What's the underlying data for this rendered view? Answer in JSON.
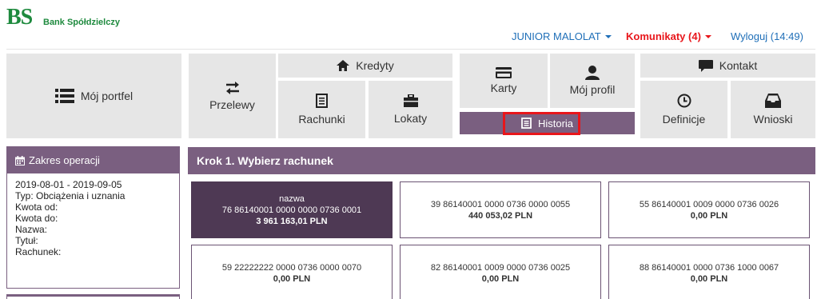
{
  "header": {
    "logo_main": "BS",
    "logo_sub": "Bank Spółdzielczy",
    "user": "JUNIOR MALOLAT",
    "komunikaty": "Komunikaty (4)",
    "wyloguj": "Wyloguj (14:49)"
  },
  "tiles": {
    "portfel": "Mój portfel",
    "przelewy": "Przelewy",
    "kredyty": "Kredyty",
    "rachunki": "Rachunki",
    "lokaty": "Lokaty",
    "karty": "Karty",
    "profil": "Mój profil",
    "historia": "Historia",
    "kontakt": "Kontakt",
    "definicje": "Definicje",
    "wnioski": "Wnioski"
  },
  "filters": {
    "title": "Zakres operacji",
    "lines": [
      "2019-08-01 - 2019-09-05",
      "Typ: Obciążenia i uznania",
      "Kwota od:",
      "Kwota do:",
      "Nazwa:",
      "Tytuł:",
      "Rachunek:"
    ]
  },
  "step": {
    "title": "Krok 1. Wybierz rachunek"
  },
  "accounts": [
    {
      "name": "nazwa",
      "number": "76 86140001 0000 0000 0736 0001",
      "amount": "3 961 163,01 PLN"
    },
    {
      "name": "",
      "number": "39 86140001 0000 0736 0000 0055",
      "amount": "440 053,02 PLN"
    },
    {
      "name": "",
      "number": "55 86140001 0009 0000 0736 0026",
      "amount": "0,00 PLN"
    },
    {
      "name": "",
      "number": "59 22222222 0000 0736 0000 0070",
      "amount": "0,00 PLN"
    },
    {
      "name": "",
      "number": "82 86140001 0009 0000 0736 0025",
      "amount": "0,00 PLN"
    },
    {
      "name": "",
      "number": "88 86140001 0000 0736 1000 0067",
      "amount": "0,00 PLN"
    }
  ],
  "icons": {
    "list": "list-icon",
    "transfer": "transfer-arrows-icon",
    "home": "home-icon",
    "document": "document-icon",
    "briefcase": "briefcase-icon",
    "card": "credit-card-icon",
    "user": "user-icon",
    "comment": "comment-icon",
    "clock": "clock-icon",
    "inbox": "inbox-icon",
    "calendar": "calendar-icon"
  },
  "colors": {
    "brand_green": "#1e8a3e",
    "purple": "#7a5f80",
    "dark_purple": "#4e3954",
    "alert_red": "#e8161b",
    "link_blue": "#1f6fb8",
    "tile_gray": "#e6e6e6"
  }
}
